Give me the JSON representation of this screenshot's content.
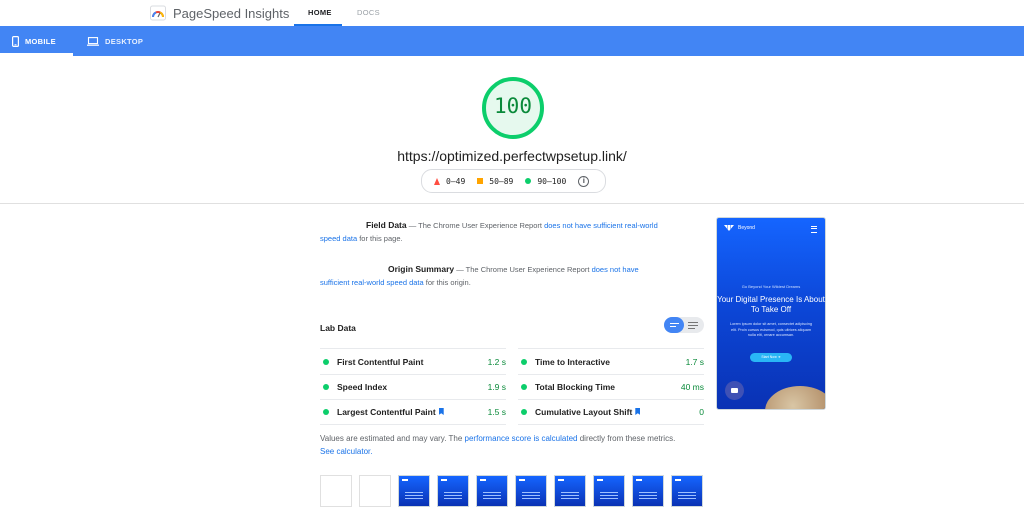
{
  "app": {
    "name": "PageSpeed Insights"
  },
  "nav": {
    "home": "HOME",
    "docs": "DOCS"
  },
  "device_tabs": {
    "mobile": "MOBILE",
    "desktop": "DESKTOP"
  },
  "score": {
    "value": "100",
    "color": "#0cce6b"
  },
  "url": "https://optimized.perfectwpsetup.link/",
  "legend": {
    "poor": "0–49",
    "average": "50–89",
    "good": "90–100"
  },
  "colors": {
    "accent": "#4285f4",
    "poor": "#ff4e42",
    "average": "#ffa400",
    "good": "#0cce6b"
  },
  "field_data": {
    "title": "Field Data",
    "prefix": "— The Chrome User Experience Report",
    "link": "does not have sufficient real-world speed data",
    "suffix": "for this page."
  },
  "origin_summary": {
    "title": "Origin Summary",
    "prefix": "— The Chrome User Experience Report",
    "link": "does not have sufficient real-world speed data",
    "suffix": "for this origin."
  },
  "lab_data": {
    "title": "Lab Data",
    "metrics": [
      {
        "label": "First Contentful Paint",
        "value": "1.2 s"
      },
      {
        "label": "Speed Index",
        "value": "1.9 s"
      },
      {
        "label": "Largest Contentful Paint",
        "value": "1.5 s"
      },
      {
        "label": "Time to Interactive",
        "value": "1.7 s"
      },
      {
        "label": "Total Blocking Time",
        "value": "40 ms"
      },
      {
        "label": "Cumulative Layout Shift",
        "value": "0"
      }
    ]
  },
  "note": {
    "prefix": "Values are estimated and may vary. The",
    "link1": "performance score is calculated",
    "middle": "directly from these metrics.",
    "link2": "See calculator."
  },
  "preview": {
    "brand": "Beyond",
    "subtitle": "Go Beyond Your Wildest Dreams",
    "headline": "Your Digital Presence Is About To Take Off",
    "body": "Lorem ipsum dolor sit amet, consectet adipiscing elit. Proin cursus euismod, quis ultrices aliquam nulla elit, ornare accumsan.",
    "button": "Start Now ➜"
  }
}
